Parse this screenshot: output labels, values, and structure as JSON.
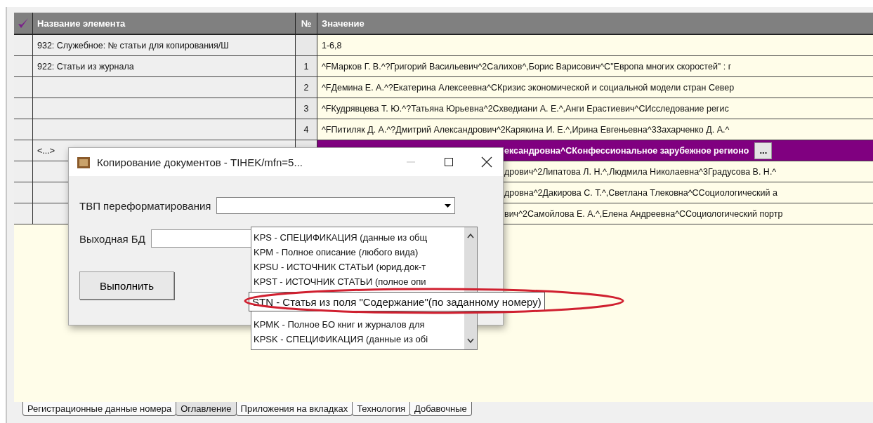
{
  "table": {
    "columns": [
      "Название элемента",
      "№",
      "Значение"
    ],
    "rows": [
      {
        "name": "932: Служебное: № статьи для копирования/Ш",
        "value": "1-6,8",
        "partly_hidden": false,
        "selected": false
      },
      {
        "name": "922: Статьи из журнала",
        "number": "1",
        "value": "^FМарков Г. В.^?Григорий Васильевич^2Салихов^,Борис Варисович^С\"Европа многих скоростей\" : г",
        "partly_hidden": false,
        "selected": false
      },
      {
        "number": "2",
        "value": "^FДемина Е. А.^?Екатерина Алексеевна^СКризис экономической и социальной модели стран Север",
        "partly_hidden": false,
        "selected": false
      },
      {
        "number": "3",
        "value": "^FКудрявцева Т. Ю.^?Татьяна Юрьевна^2Схведиани А. Е.^,Анги Ерастиевич^СИсследование регис",
        "partly_hidden": false,
        "selected": false
      },
      {
        "number": "4",
        "value": "^FПитиляк Д. А.^?Дмитрий Александрович^2Карякина И. Е.^,Ирина Евгеньевна^3Захарченко Д. А.^",
        "partly_hidden": false,
        "selected": false
      },
      {
        "name": "<...>",
        "value": "ександровна^СКонфессиональное зарубежное регионо",
        "partly_hidden": true,
        "selected": true,
        "button": "..."
      },
      {
        "value": "дрович^2Липатова Л. Н.^,Людмила Николаевна^3Градусова В. Н.^",
        "partly_hidden": true,
        "selected": false
      },
      {
        "value": "дровна^2Дакирова С. Т.^,Светлана Тлековна^ССоциологический а",
        "partly_hidden": true,
        "selected": false
      },
      {
        "value": "вич^2Самойлова Е. А.^,Елена Андреевна^ССоциологический портр",
        "partly_hidden": true,
        "selected": false
      }
    ]
  },
  "dialog": {
    "title": "Копирование документов - TIHEK/mfn=5...",
    "format_label": "ТВП переформатирования",
    "output_label": "Выходная БД",
    "run_button": "Выполнить",
    "dropdown": [
      {
        "text": "KPS - СПЕЦИФИКАЦИЯ (данные из общ",
        "selected": false
      },
      {
        "text": "KPM - Полное описание (любого вида)",
        "selected": false
      },
      {
        "text": "KPSU - ИСТОЧНИК СТАТЬИ (юрид.док-т",
        "selected": false
      },
      {
        "text": "KPST - ИСТОЧНИК СТАТЬИ (полное опи",
        "selected": false
      },
      {
        "text": "STN - Статья из поля \"Содержание\"(по заданному номеру)",
        "selected": true
      },
      {
        "text": "KPMK - Полное БО книг и журналов для",
        "selected": false
      },
      {
        "text": "KPSK - СПЕЦИФИКАЦИЯ (данные из обі",
        "selected": false
      }
    ]
  },
  "tabs": [
    {
      "label": "Регистрационные данные номера",
      "selected": false
    },
    {
      "label": "Оглавление",
      "selected": true
    },
    {
      "label": "Приложения на вкладках",
      "selected": false
    },
    {
      "label": "Технология",
      "selected": false
    },
    {
      "label": "Добавочные",
      "selected": false
    }
  ]
}
